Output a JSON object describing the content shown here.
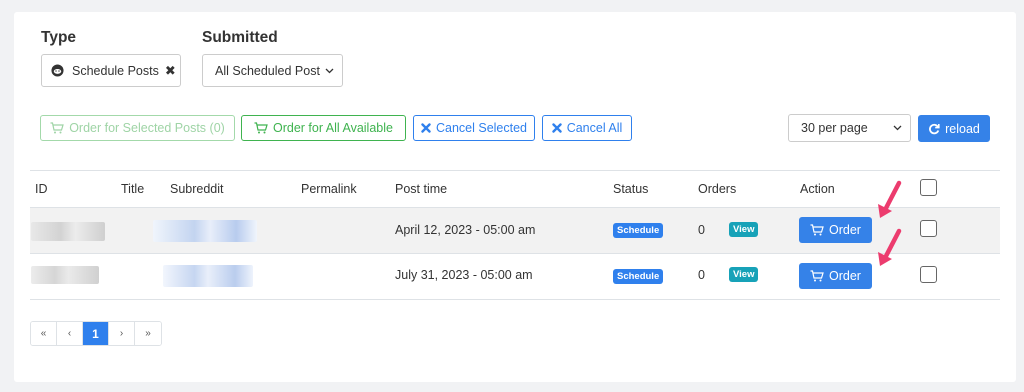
{
  "filters": {
    "type_label": "Type",
    "type_chip": "Schedule Posts",
    "submitted_label": "Submitted",
    "submitted_value": "All Scheduled Post"
  },
  "actions": {
    "order_selected": "Order for Selected Posts (0)",
    "order_all": "Order for All Available",
    "cancel_selected": "Cancel Selected",
    "cancel_all": "Cancel All",
    "per_page": "30 per page",
    "reload": "reload"
  },
  "table": {
    "headers": {
      "id": "ID",
      "title": "Title",
      "subreddit": "Subreddit",
      "permalink": "Permalink",
      "post_time": "Post time",
      "status": "Status",
      "orders": "Orders",
      "action": "Action"
    },
    "rows": [
      {
        "post_time": "April 12, 2023 - 05:00 am",
        "status": "Schedule",
        "orders": "0",
        "view": "View",
        "order": "Order"
      },
      {
        "post_time": "July 31, 2023 - 05:00 am",
        "status": "Schedule",
        "orders": "0",
        "view": "View",
        "order": "Order"
      }
    ]
  },
  "pagination": {
    "first": "«",
    "prev": "‹",
    "current": "1",
    "next": "›",
    "last": "»"
  },
  "icons": {
    "cart": "cart-icon",
    "times": "times-icon",
    "refresh": "refresh-icon",
    "reddit": "reddit-icon",
    "chevron": "chevron-down-icon",
    "annotation_arrow": "arrow-icon"
  },
  "colors": {
    "primary": "#3582e8",
    "success": "#3fb34f",
    "info": "#17a2b8",
    "annotation": "#ec3c6e"
  }
}
